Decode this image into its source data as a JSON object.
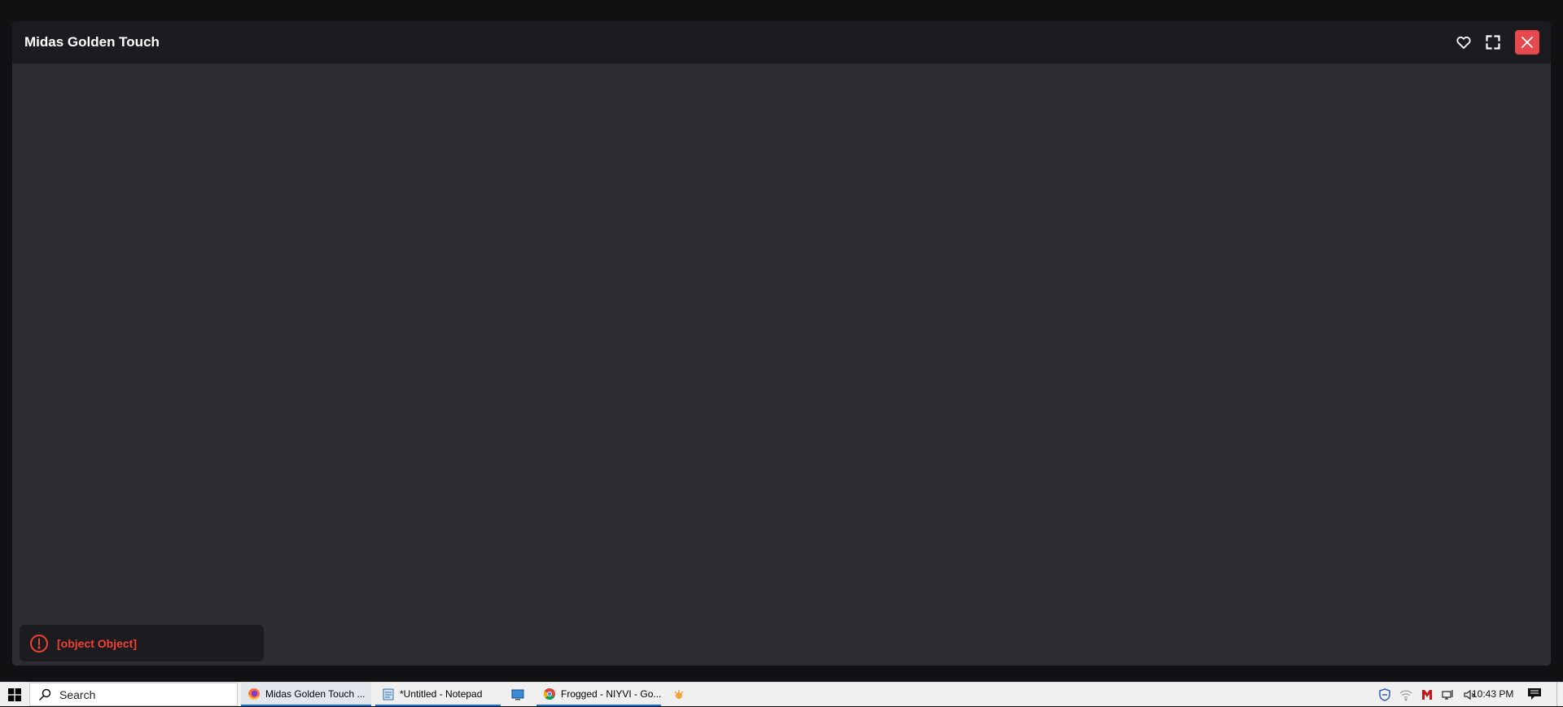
{
  "modal": {
    "title": "Midas Golden Touch",
    "actions": {
      "favorite": "heart-icon",
      "fullscreen": "fullscreen-icon",
      "close": "close-icon"
    }
  },
  "toast": {
    "message": "[object Object]",
    "icon": "error-icon",
    "color": "#f04134"
  },
  "taskbar": {
    "search_placeholder": "Search",
    "tasks": [
      {
        "label": "Midas Golden Touch ...",
        "icon": "firefox-icon"
      },
      {
        "label": "*Untitled - Notepad",
        "icon": "notepad-icon"
      },
      {
        "label": "",
        "icon": "remote-desktop-icon"
      },
      {
        "label": "Frogged - NIYVI - Go...",
        "icon": "chrome-icon"
      },
      {
        "label": "",
        "icon": "app-icon"
      }
    ],
    "clock": "10:43 PM"
  }
}
